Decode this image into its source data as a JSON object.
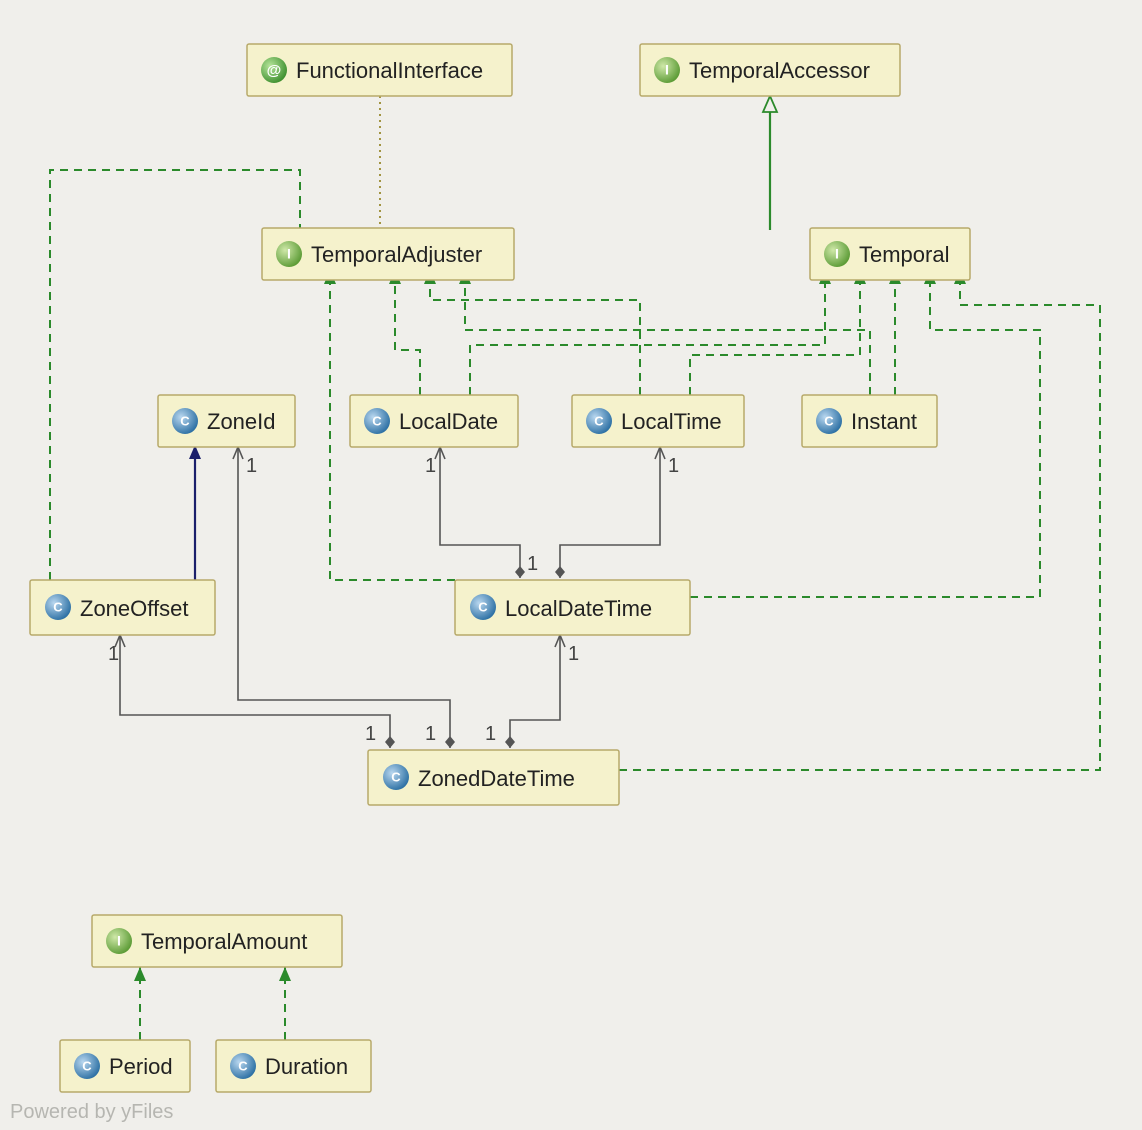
{
  "nodes": {
    "functionalInterface": {
      "label": "FunctionalInterface",
      "kind": "annotation"
    },
    "temporalAccessor": {
      "label": "TemporalAccessor",
      "kind": "interface"
    },
    "temporalAdjuster": {
      "label": "TemporalAdjuster",
      "kind": "interface"
    },
    "temporal": {
      "label": "Temporal",
      "kind": "interface"
    },
    "zoneId": {
      "label": "ZoneId",
      "kind": "class"
    },
    "localDate": {
      "label": "LocalDate",
      "kind": "class"
    },
    "localTime": {
      "label": "LocalTime",
      "kind": "class"
    },
    "instant": {
      "label": "Instant",
      "kind": "class"
    },
    "zoneOffset": {
      "label": "ZoneOffset",
      "kind": "class"
    },
    "localDateTime": {
      "label": "LocalDateTime",
      "kind": "class"
    },
    "zonedDateTime": {
      "label": "ZonedDateTime",
      "kind": "class"
    },
    "temporalAmount": {
      "label": "TemporalAmount",
      "kind": "interface"
    },
    "period": {
      "label": "Period",
      "kind": "class"
    },
    "duration": {
      "label": "Duration",
      "kind": "class"
    }
  },
  "multiplicities": {
    "zoneId_zdt": "1",
    "localDate_ldt": "1",
    "localTime_ldt": "1",
    "localDateTime_zdt": "1",
    "zoneOffset_zdt": "1",
    "zdt_zoneId": "1",
    "zdt_ldt": "1",
    "zdt_zoneOffset": "1",
    "ldt_ld": "1",
    "ldt_lt": "1"
  },
  "footer": "Powered by yFiles"
}
